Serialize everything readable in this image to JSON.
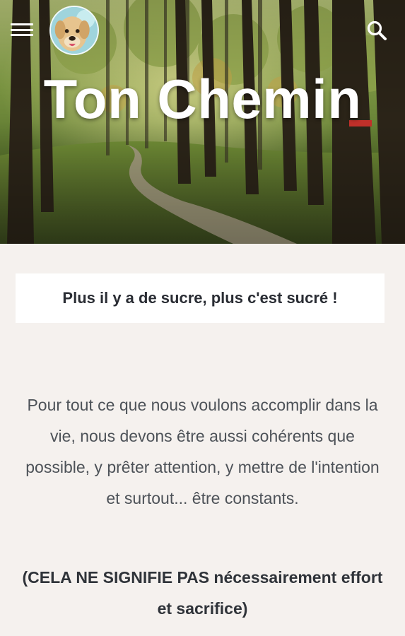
{
  "header": {
    "menu_icon": "hamburger-menu-icon",
    "avatar_icon": "dog-avatar",
    "search_icon": "search-icon",
    "site_title": "Ton Chemin"
  },
  "tagline": "Plus il y a de sucre, plus c'est sucré !",
  "intro_text": "Pour tout ce que nous voulons accomplir dans la vie, nous devons être aussi cohérents que possible, y prêter attention, y mettre de l'intention et surtout... être constants.",
  "emphasis_text": "(CELA NE SIGNIFIE PAS nécessairement effort et sacrifice)",
  "colors": {
    "page_background": "#f5f1ee",
    "card_background": "#ffffff",
    "body_text": "#4d5258",
    "heading_text": "#2a2d34",
    "header_icons": "#ffffff"
  }
}
